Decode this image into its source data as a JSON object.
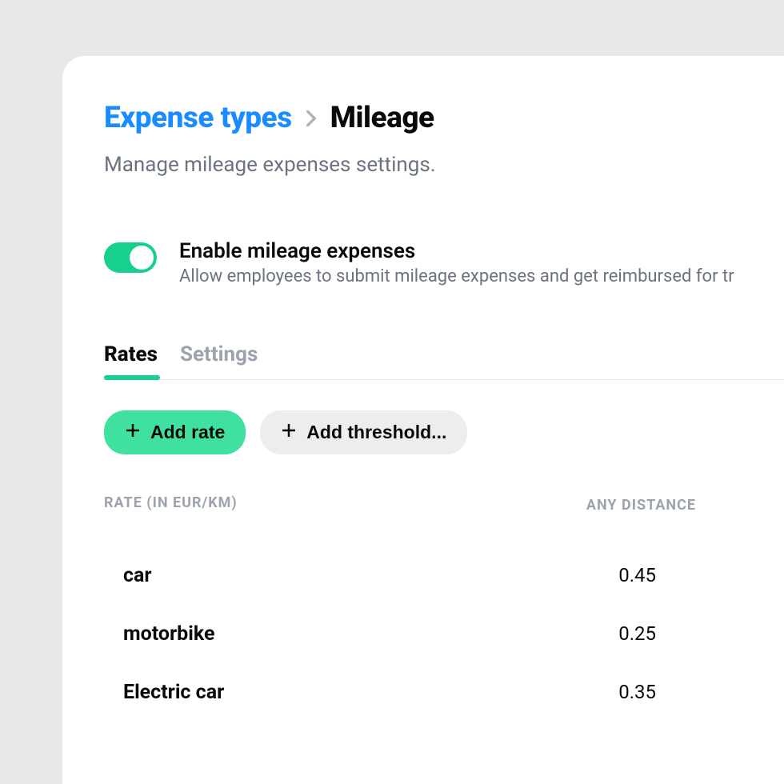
{
  "breadcrumb": {
    "parent": "Expense types",
    "current": "Mileage"
  },
  "subtitle": "Manage mileage expenses settings.",
  "enable_toggle": {
    "on": true,
    "title": "Enable mileage expenses",
    "description": "Allow employees to submit mileage expenses and get reimbursed for tr"
  },
  "tabs": [
    {
      "label": "Rates",
      "active": true
    },
    {
      "label": "Settings",
      "active": false
    }
  ],
  "buttons": {
    "add_rate": "Add rate",
    "add_threshold": "Add threshold..."
  },
  "table": {
    "header_rate": "RATE (IN EUR/KM)",
    "header_distance": "ANY DISTANCE",
    "rows": [
      {
        "name": "car",
        "value": "0.45"
      },
      {
        "name": "motorbike",
        "value": "0.25"
      },
      {
        "name": "Electric car",
        "value": "0.35"
      }
    ]
  }
}
